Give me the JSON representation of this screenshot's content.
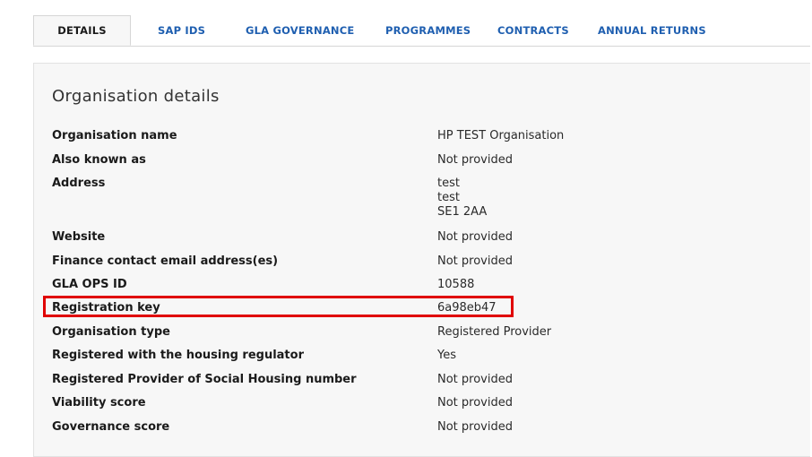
{
  "tabs": [
    {
      "label": "DETAILS",
      "active": true
    },
    {
      "label": "SAP IDS",
      "active": false
    },
    {
      "label": "GLA GOVERNANCE",
      "active": false
    },
    {
      "label": "PROGRAMMES",
      "active": false
    },
    {
      "label": "CONTRACTS",
      "active": false
    },
    {
      "label": "ANNUAL RETURNS",
      "active": false
    }
  ],
  "section": {
    "title": "Organisation details"
  },
  "details": {
    "organisation_name": {
      "label": "Organisation name",
      "value": "HP TEST Organisation"
    },
    "also_known_as": {
      "label": "Also known as",
      "value": "Not provided"
    },
    "address": {
      "label": "Address",
      "line1": "test",
      "line2": "test",
      "line3": "SE1 2AA"
    },
    "website": {
      "label": "Website",
      "value": "Not provided"
    },
    "finance_contact": {
      "label": "Finance contact email address(es)",
      "value": "Not provided"
    },
    "gla_ops_id": {
      "label": "GLA OPS ID",
      "value": "10588"
    },
    "registration_key": {
      "label": "Registration key",
      "value": "6a98eb47"
    },
    "organisation_type": {
      "label": "Organisation type",
      "value": "Registered Provider"
    },
    "registered_with_regulator": {
      "label": "Registered with the housing regulator",
      "value": "Yes"
    },
    "rp_social_housing_number": {
      "label": "Registered Provider of Social Housing number",
      "value": "Not provided"
    },
    "viability_score": {
      "label": "Viability score",
      "value": "Not provided"
    },
    "governance_score": {
      "label": "Governance score",
      "value": "Not provided"
    }
  },
  "colors": {
    "tab_link": "#1f5fb0",
    "highlight_border": "#e00000",
    "panel_bg": "#f7f7f7"
  }
}
